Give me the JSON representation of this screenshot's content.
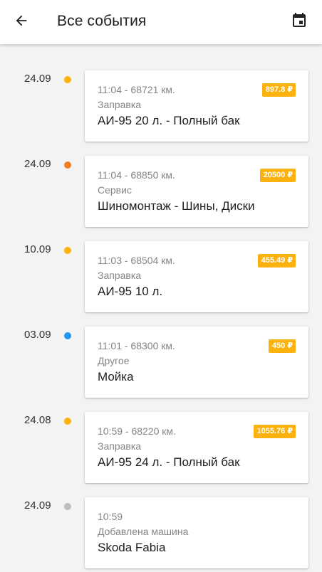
{
  "header": {
    "title": "Все события"
  },
  "events": [
    {
      "date": "24.09",
      "dot_color": "#fbb10e",
      "meta": "11:04 - 68721 км.",
      "category": "Заправка",
      "description": "АИ-95 20 л. - Полный бак",
      "price": "897.8 ₽"
    },
    {
      "date": "24.09",
      "dot_color": "#f57c1f",
      "meta": "11:04 - 68850 км.",
      "category": "Сервис",
      "description": "Шиномонтаж - Шины, Диски",
      "price": "20500 ₽"
    },
    {
      "date": "10.09",
      "dot_color": "#fbb10e",
      "meta": "11:03 - 68504 км.",
      "category": "Заправка",
      "description": "АИ-95 10 л.",
      "price": "455.49 ₽"
    },
    {
      "date": "03.09",
      "dot_color": "#2196f3",
      "meta": "11:01 - 68300 км.",
      "category": "Другое",
      "description": "Мойка",
      "price": "450 ₽"
    },
    {
      "date": "24.08",
      "dot_color": "#fbb10e",
      "meta": "10:59 - 68220 км.",
      "category": "Заправка",
      "description": "АИ-95 24 л. - Полный бак",
      "price": "1055.76 ₽"
    },
    {
      "date": "24.09",
      "dot_color": "#bdbdbd",
      "meta": "10:59",
      "category": "Добавлена машина",
      "description": "Skoda Fabia",
      "price": ""
    }
  ]
}
